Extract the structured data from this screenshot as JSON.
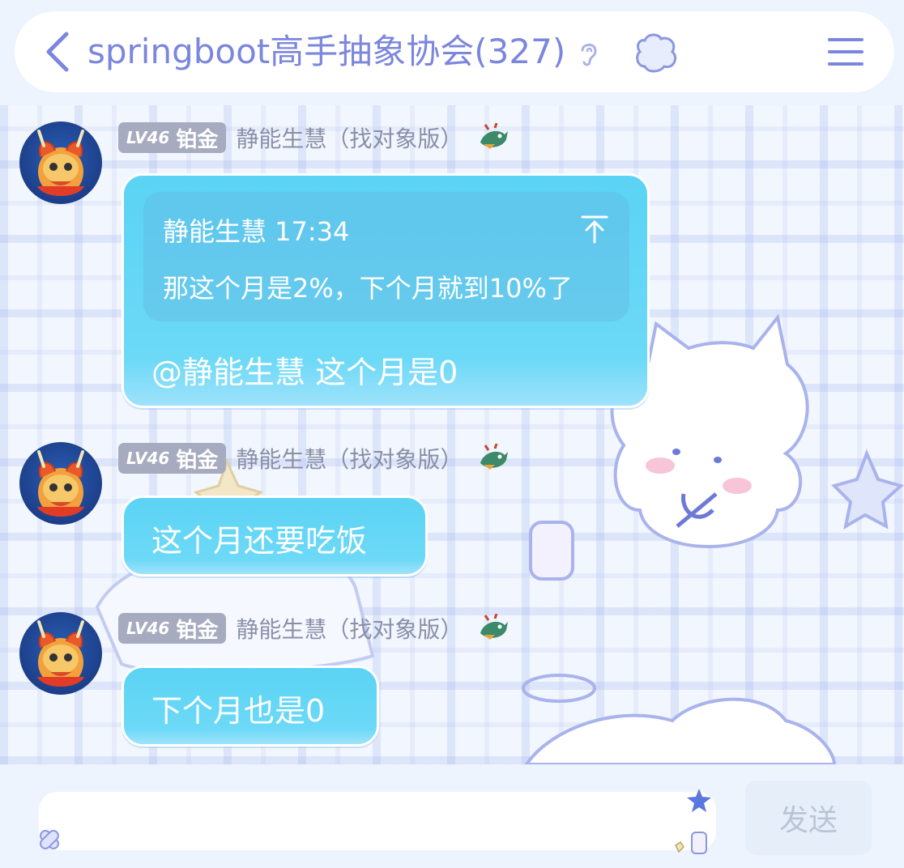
{
  "header": {
    "title": "springboot高手抽象协会(327)"
  },
  "messages": [
    {
      "level": "LV46",
      "rank": "铂金",
      "sender": "静能生慧（找对象版）",
      "quote": {
        "header": "静能生慧 17:34",
        "text": "那这个月是2%，下个月就到10%了"
      },
      "text": "@静能生慧 这个月是0"
    },
    {
      "level": "LV46",
      "rank": "铂金",
      "sender": "静能生慧（找对象版）",
      "text": "这个月还要吃饭"
    },
    {
      "level": "LV46",
      "rank": "铂金",
      "sender": "静能生慧（找对象版）",
      "text": "下个月也是0"
    }
  ],
  "composer": {
    "input_value": "",
    "send_label": "发送"
  },
  "colors": {
    "accent": "#7b86dd",
    "bubble": "#5bd3f4",
    "badge": "#a7abbf",
    "background": "#eef4fd"
  },
  "icons": [
    "back-arrow-icon",
    "ear-icon",
    "cloud-icon",
    "menu-icon",
    "dragon-icon",
    "jump-to-icon",
    "star-icon",
    "bandaid-icon",
    "bottle-icon"
  ]
}
